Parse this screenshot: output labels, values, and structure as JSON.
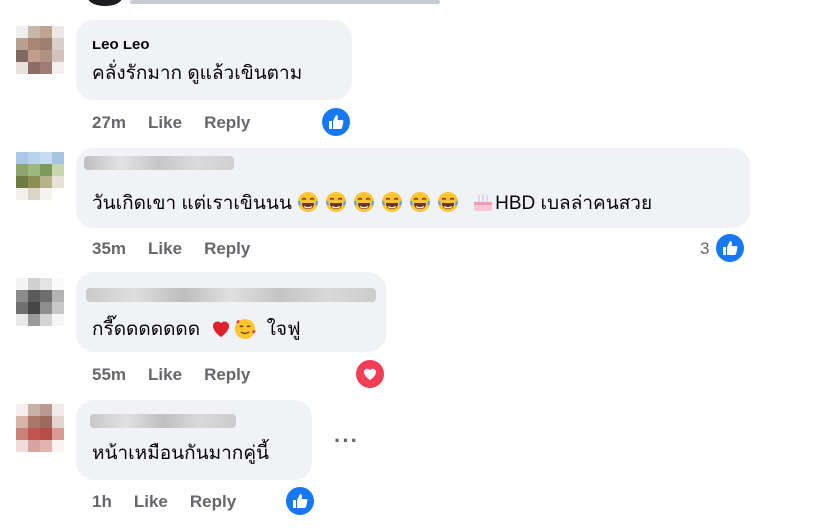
{
  "comments": [
    {
      "author": "Leo Leo",
      "text": "คลั่งรักมาก ดูแล้วเขินตาม",
      "time": "27m",
      "like_label": "Like",
      "reply_label": "Reply",
      "reaction": "like-icon"
    },
    {
      "author": "",
      "text_before": "วันเกิดเขา แต่เราเขินนน",
      "text_after": "HBD เบลล่าคนสวย",
      "emoji_laugh_count": 6,
      "time": "35m",
      "like_label": "Like",
      "reply_label": "Reply",
      "reaction": "like-icon",
      "reaction_count": "3"
    },
    {
      "author": "",
      "text_before": "กรี๊ดดดดดดด",
      "text_after": "ใจฟู",
      "time": "55m",
      "like_label": "Like",
      "reply_label": "Reply",
      "reaction": "heart-icon"
    },
    {
      "author": "",
      "text": "หน้าเหมือนกันมากคู่นี้",
      "time": "1h",
      "like_label": "Like",
      "reply_label": "Reply",
      "reaction": "like-icon",
      "more_label": "···"
    }
  ],
  "colors": {
    "bubble": "#f0f2f5",
    "meta": "#65676b",
    "like_blue": "#1877f2",
    "love_red": "#f33e58"
  }
}
